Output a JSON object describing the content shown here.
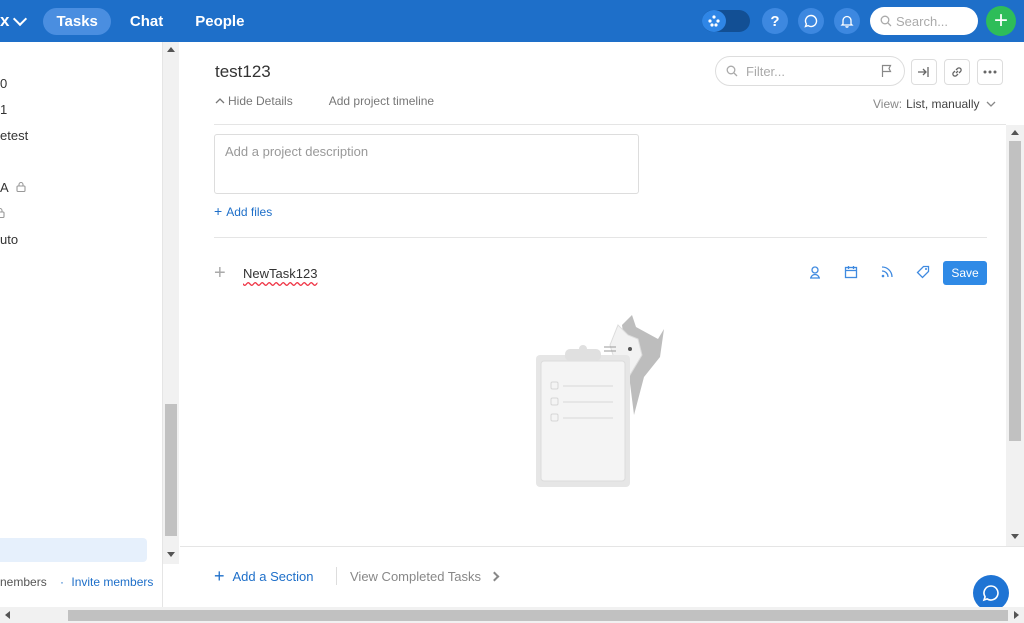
{
  "topbar": {
    "brand": "x",
    "tabs": [
      {
        "label": "Tasks",
        "active": true
      },
      {
        "label": "Chat",
        "active": false
      },
      {
        "label": "People",
        "active": false
      }
    ],
    "help_label": "?",
    "search_placeholder": "Search...",
    "add_label": "+",
    "accent": "#1e6fc9"
  },
  "sidebar": {
    "items": [
      {
        "label": "0"
      },
      {
        "label": "1"
      },
      {
        "label": "etest"
      },
      {
        "label": "",
        "locked": true
      },
      {
        "label": "A",
        "locked": true
      },
      {
        "label": "",
        "locked": true
      },
      {
        "label": "uto"
      }
    ],
    "footer_members": "nembers",
    "footer_separator": "·",
    "footer_invite": "Invite members"
  },
  "project": {
    "title": "test123",
    "hide_details": "Hide Details",
    "add_timeline": "Add project timeline",
    "filter_placeholder": "Filter...",
    "view_label": "View:",
    "view_value": "List, manually",
    "description_placeholder": "Add a project description",
    "add_files": "Add files"
  },
  "new_task": {
    "name": "NewTask123",
    "save_label": "Save"
  },
  "bottom": {
    "add_section": "Add a Section",
    "view_completed": "View Completed Tasks"
  }
}
